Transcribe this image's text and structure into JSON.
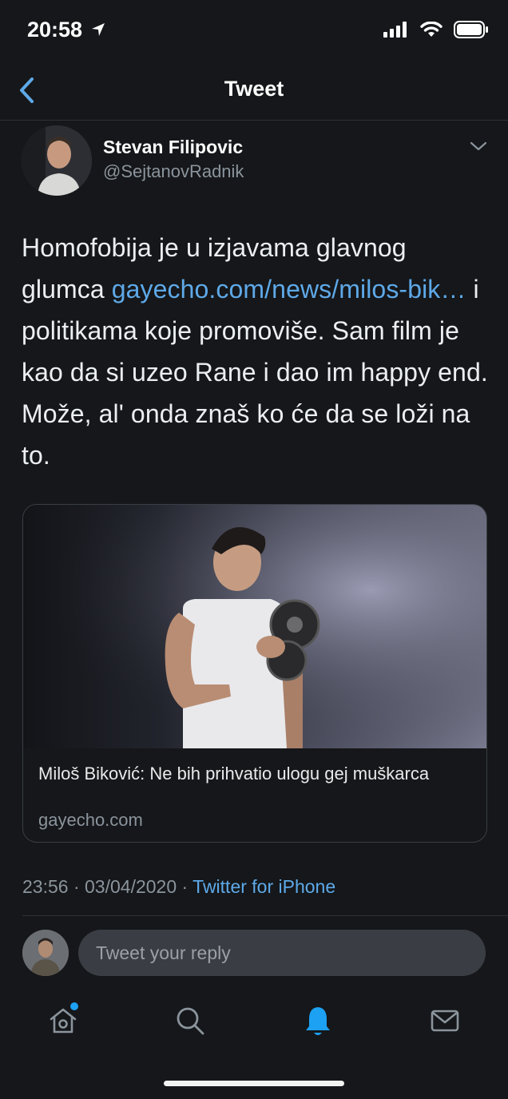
{
  "status_bar": {
    "time": "20:58",
    "icons": [
      "location-arrow-icon",
      "signal-icon",
      "wifi-icon",
      "battery-icon"
    ]
  },
  "header": {
    "title": "Tweet",
    "back_icon": "chevron-left-icon"
  },
  "tweet": {
    "author_name": "Stevan Filipovic",
    "author_handle": "@SejtanovRadnik",
    "text_before_link": "Homofobija je u izjavama glavnog glumca ",
    "link_text": "gayecho.com/news/milos-bik…",
    "text_after_link": " i politikama koje promoviše. Sam film je kao da si uzeo Rane i dao im happy end. Može, al' onda znaš ko će da se loži na to.",
    "card": {
      "title": "Miloš Biković: Ne bih prihvatio ulogu gej muškarca",
      "domain": "gayecho.com"
    },
    "time": "23:56",
    "date": "03/04/2020",
    "separator": " · ",
    "source": "Twitter for iPhone"
  },
  "reply": {
    "placeholder": "Tweet your reply"
  },
  "tabbar": {
    "items": [
      "home-icon",
      "search-icon",
      "notifications-icon",
      "messages-icon"
    ],
    "active": "notifications-icon"
  },
  "colors": {
    "background": "#15171a",
    "link": "#5ea9e8",
    "secondary_text": "#8b949c",
    "active_tab": "#1da1f2"
  }
}
